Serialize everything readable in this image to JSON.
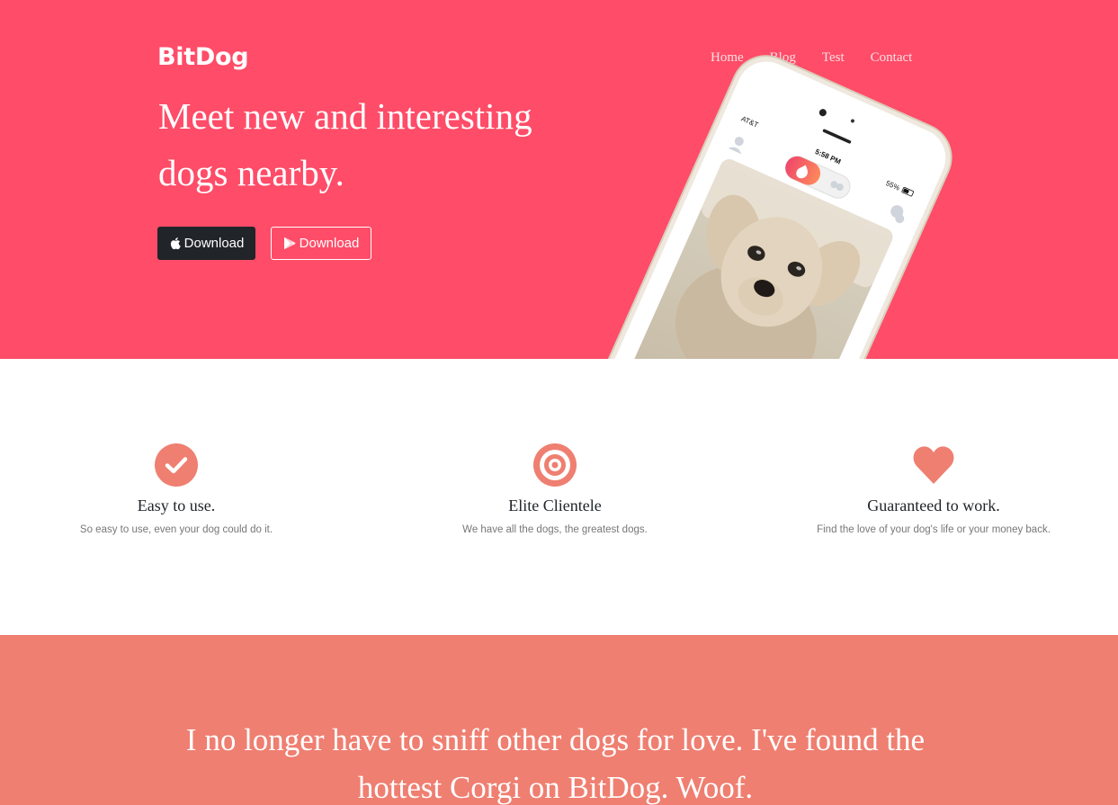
{
  "brand": "BitDog",
  "nav": [
    {
      "label": "Home"
    },
    {
      "label": "Blog"
    },
    {
      "label": "Test"
    },
    {
      "label": "Contact"
    }
  ],
  "hero": {
    "headline": "Meet new and interesting dogs nearby.",
    "buttons": {
      "apple_label": "Download",
      "play_label": "Download"
    }
  },
  "phone": {
    "carrier": "AT&T",
    "time": "5:58 PM",
    "battery": "55%"
  },
  "features": [
    {
      "icon": "check-circle-icon",
      "title": "Easy to use.",
      "text": "So easy to use, even your dog could do it."
    },
    {
      "icon": "bullseye-icon",
      "title": "Elite Clientele",
      "text": "We have all the dogs, the greatest dogs."
    },
    {
      "icon": "heart-icon",
      "title": "Guaranteed to work.",
      "text": "Find the love of your dog's life or your money back."
    }
  ],
  "testimonial": {
    "quote": "I no longer have to sniff other dogs for love. I've found the hottest Corgi on BitDog. Woof."
  },
  "colors": {
    "hero_bg": "#ff4c68",
    "accent": "#ef7f71",
    "dark_button": "#212529"
  }
}
